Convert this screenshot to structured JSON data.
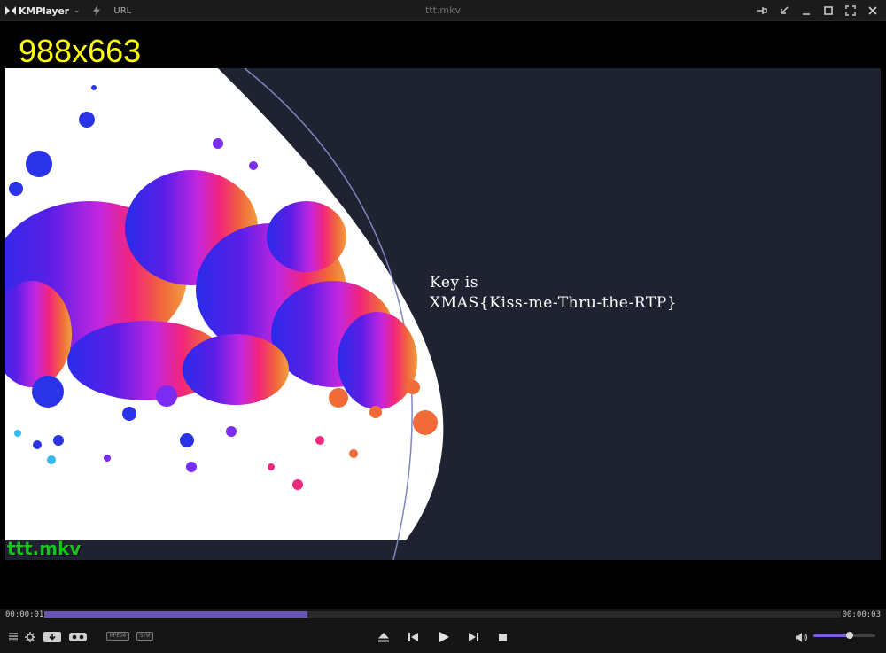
{
  "app": {
    "name": "KMPlayer",
    "window_title": "ttt.mkv",
    "url_label": "URL"
  },
  "titlebar_buttons": [
    "pin-icon",
    "mini-mode-icon",
    "minimize-icon",
    "maximize-icon",
    "fullscreen-icon",
    "close-icon"
  ],
  "video": {
    "osd_resolution": "988x663",
    "osd_filename": "ttt.mkv",
    "overlay_text_line1": "Key is",
    "overlay_text_line2": "XMAS{Kiss-me-Thru-the-RTP}"
  },
  "playback": {
    "time_current": "00:00:01",
    "time_total": "00:00:03",
    "progress_fraction": 0.33,
    "volume_fraction": 0.58
  },
  "badges": {
    "codec": "MPEG4",
    "renderer": "S/W"
  },
  "colors": {
    "accent": "#6a54b3",
    "osd_resolution": "#ffff00",
    "osd_filename": "#15c31a",
    "video_bg": "#1f2331"
  }
}
